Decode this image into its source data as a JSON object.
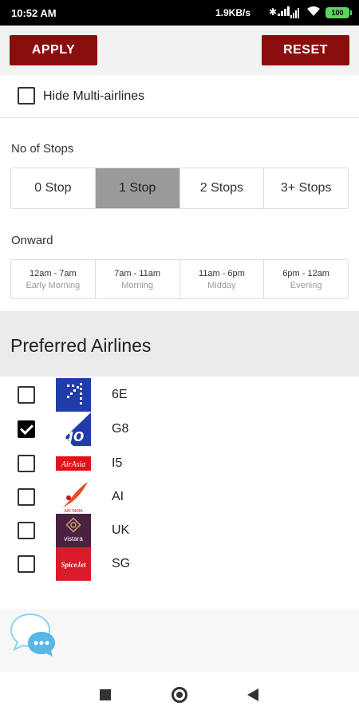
{
  "status_bar": {
    "time": "10:52 AM",
    "network_speed": "1.9KB/s",
    "battery": "100"
  },
  "actions": {
    "apply_label": "APPLY",
    "reset_label": "RESET"
  },
  "hide_multi_airlines": {
    "label": "Hide Multi-airlines",
    "checked": false
  },
  "stops": {
    "label": "No of Stops",
    "options": [
      "0 Stop",
      "1 Stop",
      "2 Stops",
      "3+ Stops"
    ],
    "selected": "1 Stop"
  },
  "onward": {
    "label": "Onward",
    "slots": [
      {
        "time": "12am - 7am",
        "name": "Early Morning"
      },
      {
        "time": "7am - 11am",
        "name": "Morning"
      },
      {
        "time": "11am - 6pm",
        "name": "Midday"
      },
      {
        "time": "6pm - 12am",
        "name": "Evening"
      }
    ]
  },
  "preferred_airlines": {
    "title": "Preferred Airlines",
    "items": [
      {
        "code": "6E",
        "checked": false,
        "logo": "indigo-logo"
      },
      {
        "code": "G8",
        "checked": true,
        "logo": "goair-logo"
      },
      {
        "code": "I5",
        "checked": false,
        "logo": "airasia-logo"
      },
      {
        "code": "AI",
        "checked": false,
        "logo": "air-india-logo"
      },
      {
        "code": "UK",
        "checked": false,
        "logo": "vistara-logo"
      },
      {
        "code": "SG",
        "checked": false,
        "logo": "spicejet-logo"
      }
    ],
    "logo_text": {
      "g8": "go",
      "i5": "AirAsia",
      "ai": "AIR INDIA",
      "uk": "vistara",
      "sg": "SpiceJet"
    }
  },
  "colors": {
    "brand": "#8b0e0e",
    "selected_stop": "#9a9a9a"
  },
  "icons": {
    "chat": "chat-bubbles-icon",
    "nav_recent": "square-icon",
    "nav_home": "circle-icon",
    "nav_back": "back-triangle-icon"
  }
}
